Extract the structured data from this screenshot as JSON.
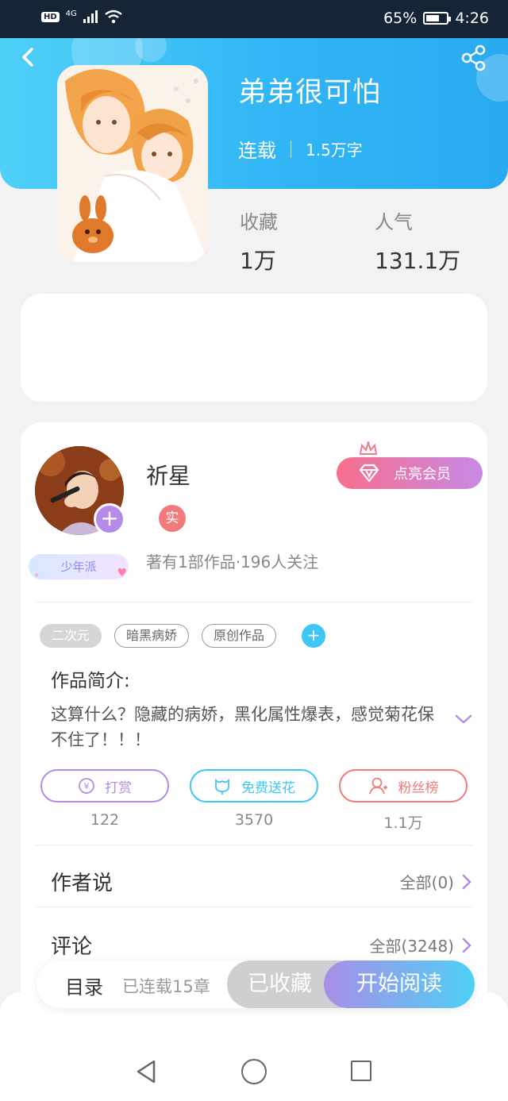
{
  "status_bar": {
    "hd": "HD",
    "network": "4G",
    "battery_percent": "65%",
    "battery_level": 0.65,
    "time": "4:26"
  },
  "book": {
    "title": "弟弟很可怕",
    "status": "连载",
    "word_count": "1.5万字",
    "stats": [
      {
        "label": "收藏",
        "value": "1万"
      },
      {
        "label": "人气",
        "value": "131.1万"
      }
    ]
  },
  "author": {
    "name": "祈星",
    "verified_badge": "实",
    "tier_badge": "少年派",
    "meta": "著有1部作品·196人关注",
    "vip_button": "点亮会员"
  },
  "tags": [
    "二次元",
    "暗黑病娇",
    "原创作品"
  ],
  "intro": {
    "title": "作品简介:",
    "text": "这算什么？隐藏的病娇，黑化属性爆表，感觉菊花保不住了！！！"
  },
  "actions": [
    {
      "label": "打赏",
      "count": "122",
      "color": "#b58ae8",
      "icon": "coin-icon"
    },
    {
      "label": "免费送花",
      "count": "3570",
      "color": "#3fc6f4",
      "icon": "flower-icon"
    },
    {
      "label": "粉丝榜",
      "count": "1.1万",
      "color": "#f27a7a",
      "icon": "fan-user-icon"
    }
  ],
  "sections": [
    {
      "title": "作者说",
      "more": "全部(0)"
    },
    {
      "title": "评论",
      "more": "全部(3248)"
    }
  ],
  "bottom_bar": {
    "toc": "目录",
    "chapters": "已连载15章",
    "collected": "已收藏",
    "read": "开始阅读"
  },
  "colors": {
    "header_gradient": [
      "#4fd0f7",
      "#2aaaf0"
    ],
    "accent_purple": "#b58ae8",
    "accent_blue": "#3fc6f4",
    "accent_red": "#f27a7a"
  }
}
